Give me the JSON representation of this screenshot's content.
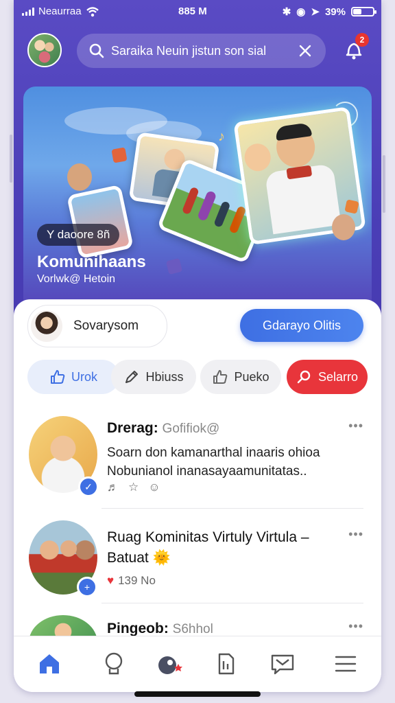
{
  "status_bar": {
    "carrier": "Neaurraa",
    "time": "885 M",
    "battery": "39%",
    "battery_level": 0.39
  },
  "search": {
    "placeholder": "Saraika Neuin jistun son sial"
  },
  "notification": {
    "count": "2"
  },
  "hero": {
    "chip": "Y daoore 8ñ",
    "title": "Komunihaans",
    "subtitle": "Vorlwk@ Hetoin"
  },
  "profile": {
    "name": "Sovarysom",
    "cta_label": "Gdarayo Olitis"
  },
  "filters": [
    {
      "label": "Urok",
      "icon": "thumbs-up-icon"
    },
    {
      "label": "Hbiuss",
      "icon": "pencil-icon"
    },
    {
      "label": "Pueko",
      "icon": "like-icon"
    },
    {
      "label": "Selarro",
      "icon": "search-icon"
    }
  ],
  "feed": [
    {
      "author": "Drerag:",
      "handle": "Gofifiok@",
      "text_line1": "Soarn don kamanarthal inaaris ohioa",
      "text_line2": "Nobunianol inanasayaamunitatas.."
    },
    {
      "title_line1": "Ruag Kominitas Virtuly Virtula –",
      "title_line2": "Batuat",
      "likes": "139 No"
    },
    {
      "author": "Pingeob:",
      "handle": "S6hhol"
    }
  ],
  "colors": {
    "brand": "#4b3fb7",
    "accent_blue": "#3e6fe3",
    "accent_red": "#e8353b"
  }
}
